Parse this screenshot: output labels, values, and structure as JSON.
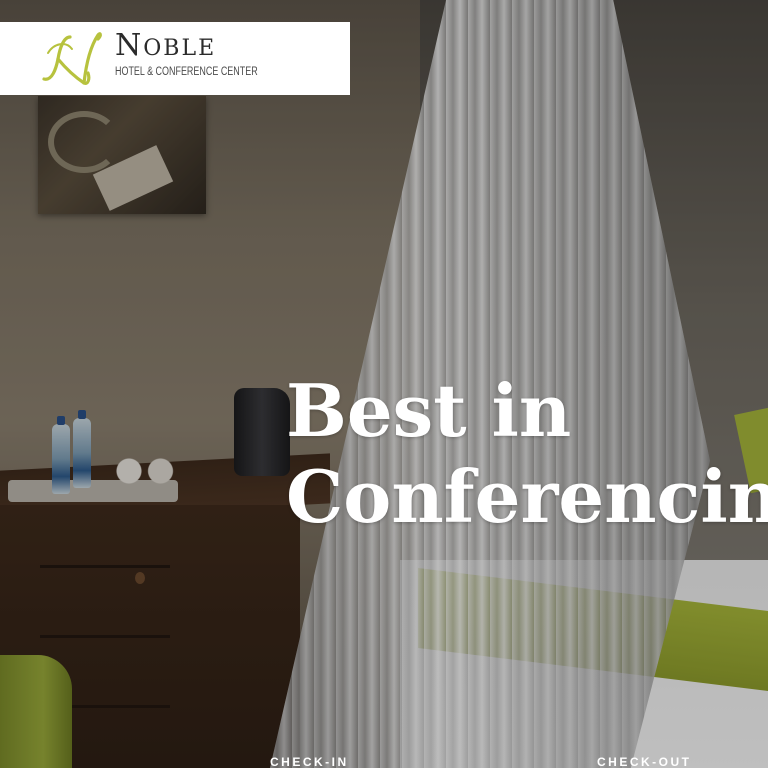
{
  "header": {
    "logo": {
      "initial_mark": "N",
      "name": "Noble",
      "subtitle": "HOTEL & CONFERENCE CENTER",
      "brand_color": "#b7c23e"
    }
  },
  "hero": {
    "headline_line1": "Best in",
    "headline_line2": "Conferencing",
    "image_description_icon": "hotel-room-photo"
  },
  "booking": {
    "checkin_label": "CHECK-IN",
    "checkout_label": "CHECK-OUT"
  }
}
